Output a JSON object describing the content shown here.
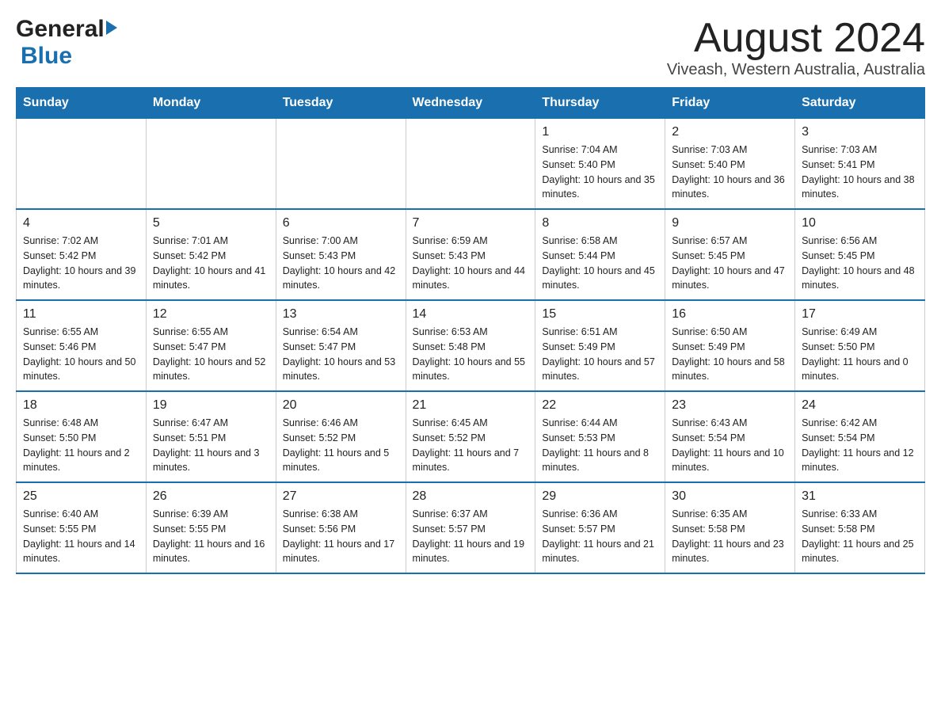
{
  "header": {
    "logo_general": "General",
    "logo_blue": "Blue",
    "month_title": "August 2024",
    "location": "Viveash, Western Australia, Australia"
  },
  "calendar": {
    "days_of_week": [
      "Sunday",
      "Monday",
      "Tuesday",
      "Wednesday",
      "Thursday",
      "Friday",
      "Saturday"
    ],
    "weeks": [
      [
        {
          "day": "",
          "info": ""
        },
        {
          "day": "",
          "info": ""
        },
        {
          "day": "",
          "info": ""
        },
        {
          "day": "",
          "info": ""
        },
        {
          "day": "1",
          "info": "Sunrise: 7:04 AM\nSunset: 5:40 PM\nDaylight: 10 hours and 35 minutes."
        },
        {
          "day": "2",
          "info": "Sunrise: 7:03 AM\nSunset: 5:40 PM\nDaylight: 10 hours and 36 minutes."
        },
        {
          "day": "3",
          "info": "Sunrise: 7:03 AM\nSunset: 5:41 PM\nDaylight: 10 hours and 38 minutes."
        }
      ],
      [
        {
          "day": "4",
          "info": "Sunrise: 7:02 AM\nSunset: 5:42 PM\nDaylight: 10 hours and 39 minutes."
        },
        {
          "day": "5",
          "info": "Sunrise: 7:01 AM\nSunset: 5:42 PM\nDaylight: 10 hours and 41 minutes."
        },
        {
          "day": "6",
          "info": "Sunrise: 7:00 AM\nSunset: 5:43 PM\nDaylight: 10 hours and 42 minutes."
        },
        {
          "day": "7",
          "info": "Sunrise: 6:59 AM\nSunset: 5:43 PM\nDaylight: 10 hours and 44 minutes."
        },
        {
          "day": "8",
          "info": "Sunrise: 6:58 AM\nSunset: 5:44 PM\nDaylight: 10 hours and 45 minutes."
        },
        {
          "day": "9",
          "info": "Sunrise: 6:57 AM\nSunset: 5:45 PM\nDaylight: 10 hours and 47 minutes."
        },
        {
          "day": "10",
          "info": "Sunrise: 6:56 AM\nSunset: 5:45 PM\nDaylight: 10 hours and 48 minutes."
        }
      ],
      [
        {
          "day": "11",
          "info": "Sunrise: 6:55 AM\nSunset: 5:46 PM\nDaylight: 10 hours and 50 minutes."
        },
        {
          "day": "12",
          "info": "Sunrise: 6:55 AM\nSunset: 5:47 PM\nDaylight: 10 hours and 52 minutes."
        },
        {
          "day": "13",
          "info": "Sunrise: 6:54 AM\nSunset: 5:47 PM\nDaylight: 10 hours and 53 minutes."
        },
        {
          "day": "14",
          "info": "Sunrise: 6:53 AM\nSunset: 5:48 PM\nDaylight: 10 hours and 55 minutes."
        },
        {
          "day": "15",
          "info": "Sunrise: 6:51 AM\nSunset: 5:49 PM\nDaylight: 10 hours and 57 minutes."
        },
        {
          "day": "16",
          "info": "Sunrise: 6:50 AM\nSunset: 5:49 PM\nDaylight: 10 hours and 58 minutes."
        },
        {
          "day": "17",
          "info": "Sunrise: 6:49 AM\nSunset: 5:50 PM\nDaylight: 11 hours and 0 minutes."
        }
      ],
      [
        {
          "day": "18",
          "info": "Sunrise: 6:48 AM\nSunset: 5:50 PM\nDaylight: 11 hours and 2 minutes."
        },
        {
          "day": "19",
          "info": "Sunrise: 6:47 AM\nSunset: 5:51 PM\nDaylight: 11 hours and 3 minutes."
        },
        {
          "day": "20",
          "info": "Sunrise: 6:46 AM\nSunset: 5:52 PM\nDaylight: 11 hours and 5 minutes."
        },
        {
          "day": "21",
          "info": "Sunrise: 6:45 AM\nSunset: 5:52 PM\nDaylight: 11 hours and 7 minutes."
        },
        {
          "day": "22",
          "info": "Sunrise: 6:44 AM\nSunset: 5:53 PM\nDaylight: 11 hours and 8 minutes."
        },
        {
          "day": "23",
          "info": "Sunrise: 6:43 AM\nSunset: 5:54 PM\nDaylight: 11 hours and 10 minutes."
        },
        {
          "day": "24",
          "info": "Sunrise: 6:42 AM\nSunset: 5:54 PM\nDaylight: 11 hours and 12 minutes."
        }
      ],
      [
        {
          "day": "25",
          "info": "Sunrise: 6:40 AM\nSunset: 5:55 PM\nDaylight: 11 hours and 14 minutes."
        },
        {
          "day": "26",
          "info": "Sunrise: 6:39 AM\nSunset: 5:55 PM\nDaylight: 11 hours and 16 minutes."
        },
        {
          "day": "27",
          "info": "Sunrise: 6:38 AM\nSunset: 5:56 PM\nDaylight: 11 hours and 17 minutes."
        },
        {
          "day": "28",
          "info": "Sunrise: 6:37 AM\nSunset: 5:57 PM\nDaylight: 11 hours and 19 minutes."
        },
        {
          "day": "29",
          "info": "Sunrise: 6:36 AM\nSunset: 5:57 PM\nDaylight: 11 hours and 21 minutes."
        },
        {
          "day": "30",
          "info": "Sunrise: 6:35 AM\nSunset: 5:58 PM\nDaylight: 11 hours and 23 minutes."
        },
        {
          "day": "31",
          "info": "Sunrise: 6:33 AM\nSunset: 5:58 PM\nDaylight: 11 hours and 25 minutes."
        }
      ]
    ]
  }
}
